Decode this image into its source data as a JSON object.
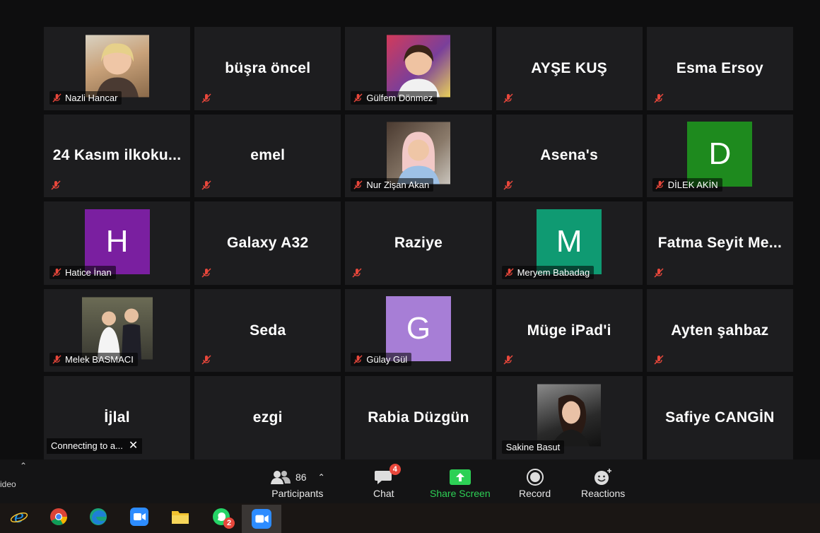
{
  "tiles": [
    {
      "name": "Nazli Hancar",
      "type": "photo"
    },
    {
      "name": "büşra öncel",
      "type": "name"
    },
    {
      "name": "Gülfem Dönmez",
      "type": "photo"
    },
    {
      "name": "AYŞE KUŞ",
      "type": "name"
    },
    {
      "name": "Esma Ersoy",
      "type": "name"
    },
    {
      "name": "24 Kasım ilkoku...",
      "type": "name"
    },
    {
      "name": "emel",
      "type": "name"
    },
    {
      "name": "Nur Zişan Akan",
      "type": "photo"
    },
    {
      "name": "Asena's",
      "type": "name"
    },
    {
      "name": "DİLEK AKİN",
      "type": "avatar",
      "letter": "D",
      "color": "#1e8a1e"
    },
    {
      "name": "Hatice İnan",
      "type": "avatar",
      "letter": "H",
      "color": "#7a1fa0"
    },
    {
      "name": "Galaxy A32",
      "type": "name"
    },
    {
      "name": "Raziye",
      "type": "name"
    },
    {
      "name": "Meryem Babadag",
      "type": "avatar",
      "letter": "M",
      "color": "#0f9a72"
    },
    {
      "name": "Fatma Seyit Me...",
      "type": "name"
    },
    {
      "name": "Melek BASMACI",
      "type": "photo"
    },
    {
      "name": "Seda",
      "type": "name"
    },
    {
      "name": "Gülay Gül",
      "type": "avatar",
      "letter": "G",
      "color": "#a77ed6"
    },
    {
      "name": "Müge iPad'i",
      "type": "name"
    },
    {
      "name": "Ayten şahbaz",
      "type": "name"
    },
    {
      "name": "İjlal",
      "type": "name"
    },
    {
      "name": "ezgi",
      "type": "name"
    },
    {
      "name": "Rabia Düzgün",
      "type": "name"
    },
    {
      "name": "Sakine Basut",
      "type": "photo"
    },
    {
      "name": "Safiye CANGİN",
      "type": "name"
    }
  ],
  "connecting": "Connecting to a...",
  "toolbar": {
    "participants_label": "Participants",
    "participants_count": "86",
    "chat_label": "Chat",
    "chat_badge": "4",
    "share_label": "Share Screen",
    "record_label": "Record",
    "reactions_label": "Reactions"
  },
  "left_edge": "ideo",
  "taskbar": {
    "whatsapp_badge": "2"
  },
  "colors": {
    "share_green": "#2dd055",
    "mute_red": "#e8473b"
  }
}
